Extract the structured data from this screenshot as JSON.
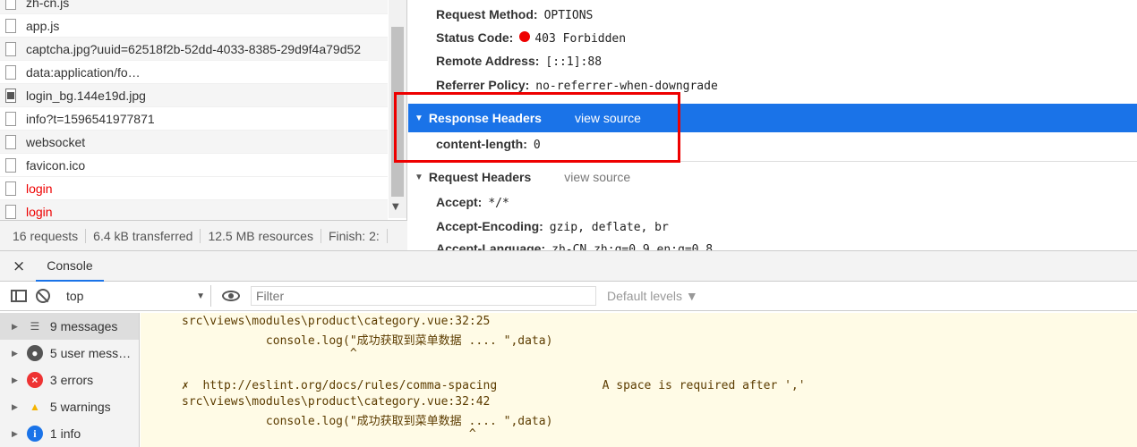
{
  "network": {
    "rows": [
      {
        "name": "zh-cn.js",
        "type": "file",
        "alt": true,
        "error": false
      },
      {
        "name": "app.js",
        "type": "file",
        "alt": false,
        "error": false
      },
      {
        "name": "captcha.jpg?uuid=62518f2b-52dd-4033-8385-29d9f4a79d52",
        "type": "file",
        "alt": true,
        "error": false
      },
      {
        "name": "data:application/fo…",
        "type": "file",
        "alt": false,
        "error": false
      },
      {
        "name": "login_bg.144e19d.jpg",
        "type": "image",
        "alt": true,
        "error": false
      },
      {
        "name": "info?t=1596541977871",
        "type": "file",
        "alt": false,
        "error": false
      },
      {
        "name": "websocket",
        "type": "file",
        "alt": true,
        "error": false
      },
      {
        "name": "favicon.ico",
        "type": "file",
        "alt": false,
        "error": false
      },
      {
        "name": "login",
        "type": "file",
        "alt": false,
        "error": true
      },
      {
        "name": "login",
        "type": "file",
        "alt": true,
        "error": true
      }
    ],
    "footer": {
      "requests": "16 requests",
      "transferred": "6.4 kB transferred",
      "resources": "12.5 MB resources",
      "finish": "Finish: 2:"
    }
  },
  "details": {
    "general": [
      {
        "key": "Request Method:",
        "value": "OPTIONS"
      },
      {
        "key": "Status Code:",
        "value": "403 Forbidden"
      },
      {
        "key": "Remote Address:",
        "value": "[::1]:88"
      },
      {
        "key": "Referrer Policy:",
        "value": "no-referrer-when-downgrade"
      }
    ],
    "response_headers": {
      "title": "Response Headers",
      "view_source": "view source",
      "items": [
        {
          "key": "content-length:",
          "value": "0"
        }
      ]
    },
    "request_headers": {
      "title": "Request Headers",
      "view_source": "view source",
      "items": [
        {
          "key": "Accept:",
          "value": "*/*"
        },
        {
          "key": "Accept-Encoding:",
          "value": "gzip, deflate, br"
        },
        {
          "key": "Accept-Language:",
          "value": "zh-CN,zh;q=0.9,en;q=0.8"
        }
      ]
    },
    "status_color": "#e00000",
    "highlight_color": "#e00000"
  },
  "console": {
    "tab_close": "×",
    "tab_label": "Console",
    "context": "top",
    "filter_placeholder": "Filter",
    "levels_label": "Default levels ▼",
    "sidebar": [
      {
        "label": "9 messages",
        "icon": "list-icon",
        "selected": true
      },
      {
        "label": "5 user mess…",
        "icon": "user-icon",
        "selected": false
      },
      {
        "label": "3 errors",
        "icon": "error-icon",
        "selected": false
      },
      {
        "label": "5 warnings",
        "icon": "warning-icon",
        "selected": false
      },
      {
        "label": "1 info",
        "icon": "info-icon",
        "selected": false
      }
    ],
    "lines": [
      "src\\views\\modules\\product\\category.vue:32:25",
      "            console.log(\"成功获取到菜单数据 .... \",data)",
      "                        ^",
      "✗  http://eslint.org/docs/rules/comma-spacing               A space is required after ','",
      "src\\views\\modules\\product\\category.vue:32:42",
      "            console.log(\"成功获取到菜单数据 .... \",data)",
      "                                         ^"
    ]
  }
}
